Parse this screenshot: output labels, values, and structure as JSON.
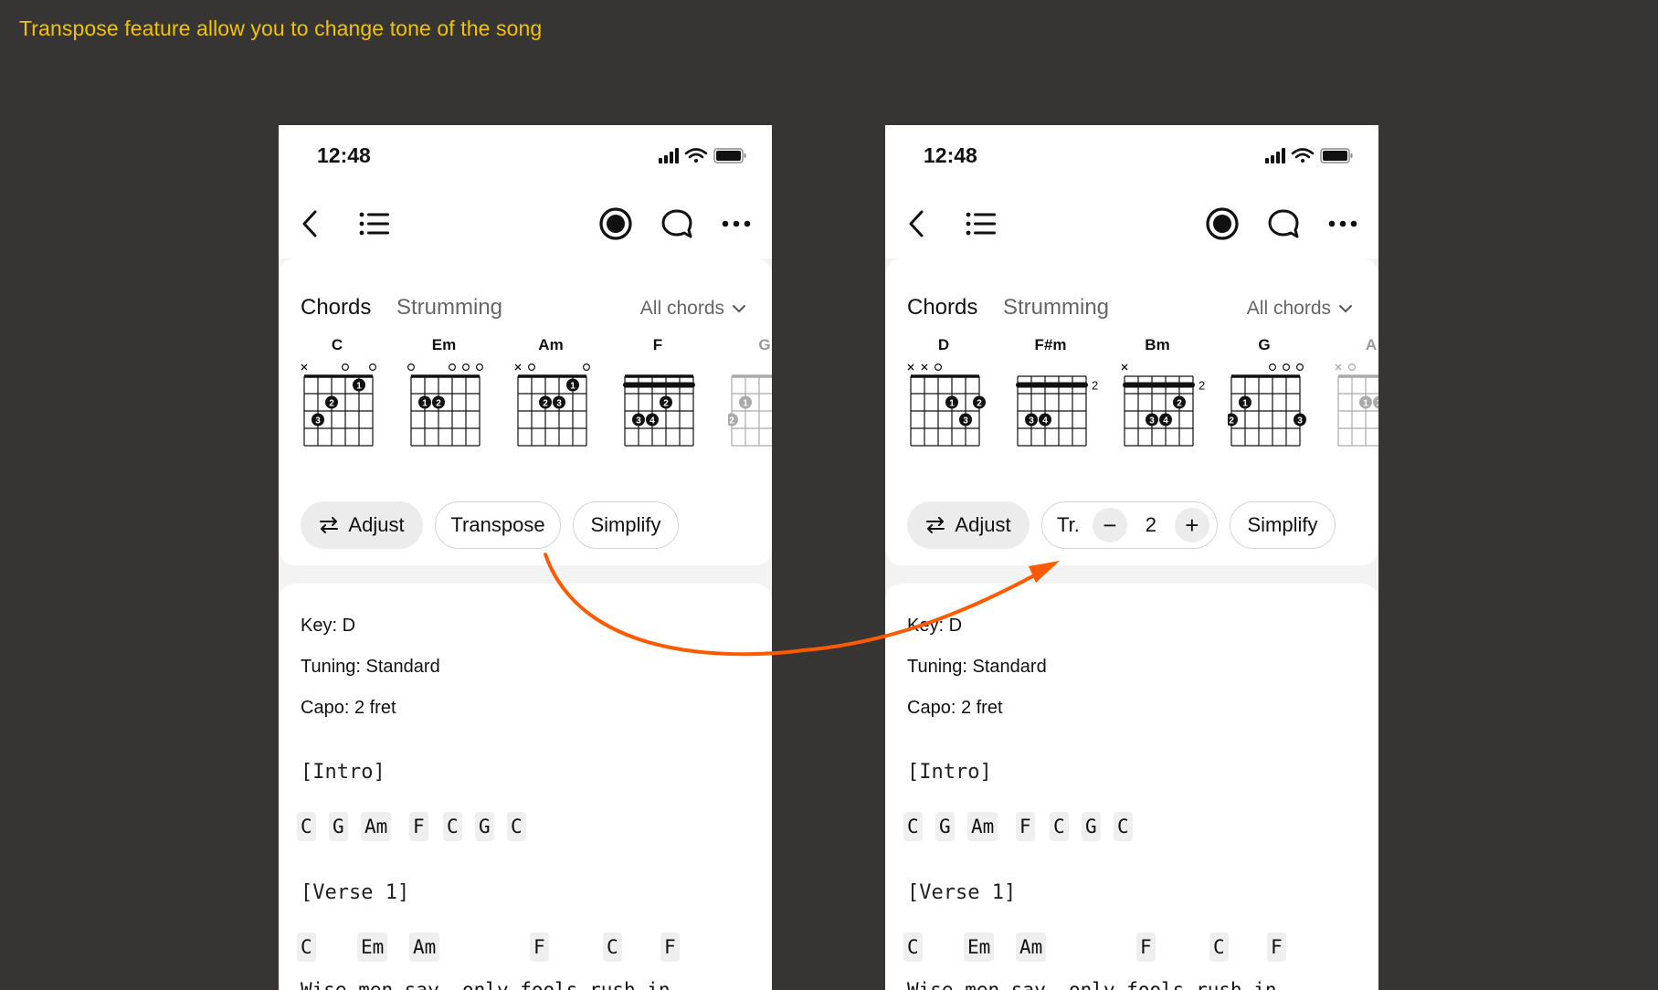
{
  "caption": "Transpose feature allow you to change tone of the song",
  "screens": [
    {
      "time": "12:48",
      "tabs": {
        "chords": "Chords",
        "strumming": "Strumming",
        "filter": "All chords"
      },
      "chords": [
        "C",
        "Em",
        "Am",
        "F",
        "G"
      ],
      "buttons": {
        "adjust": "Adjust",
        "transpose": "Transpose",
        "simplify": "Simplify"
      },
      "meta": {
        "key_label": "Key:",
        "key_value": "D",
        "tuning_label": "Tuning:",
        "tuning_value": "Standard",
        "capo_label": "Capo:",
        "capo_value": "2 fret"
      },
      "intro_label": "[Intro]",
      "intro_chords": [
        "C",
        "G",
        "Am",
        "F",
        "C",
        "G",
        "C"
      ],
      "verse_label": "[Verse 1]",
      "verse_chords": [
        "C",
        "Em",
        "Am",
        "F",
        "C",
        "F"
      ],
      "lyric": "Wise men say, only fools rush in"
    },
    {
      "time": "12:48",
      "tabs": {
        "chords": "Chords",
        "strumming": "Strumming",
        "filter": "All chords"
      },
      "chords": [
        "D",
        "F#m",
        "Bm",
        "G",
        "A"
      ],
      "fret_labels": [
        "2",
        "2"
      ],
      "buttons": {
        "adjust": "Adjust",
        "transpose_short": "Tr.",
        "minus": "−",
        "value": "2",
        "plus": "+",
        "simplify": "Simplify"
      },
      "transpose_value": 2,
      "meta": {
        "key_label": "Key:",
        "key_value": "D",
        "tuning_label": "Tuning:",
        "tuning_value": "Standard",
        "capo_label": "Capo:",
        "capo_value": "2 fret"
      },
      "intro_label": "[Intro]",
      "intro_chords": [
        "C",
        "G",
        "Am",
        "F",
        "C",
        "G",
        "C"
      ],
      "verse_label": "[Verse 1]",
      "verse_chords": [
        "C",
        "Em",
        "Am",
        "F",
        "C",
        "F"
      ],
      "lyric": "Wise men say, only fools rush in"
    }
  ],
  "colors": {
    "background": "#363534",
    "caption": "#f2c200",
    "arrow": "#ff5a00"
  },
  "icons": [
    "back-icon",
    "list-icon",
    "record-icon",
    "comment-icon",
    "more-icon",
    "chevron-down-icon",
    "swap-icon",
    "signal-icon",
    "wifi-icon",
    "battery-icon"
  ]
}
